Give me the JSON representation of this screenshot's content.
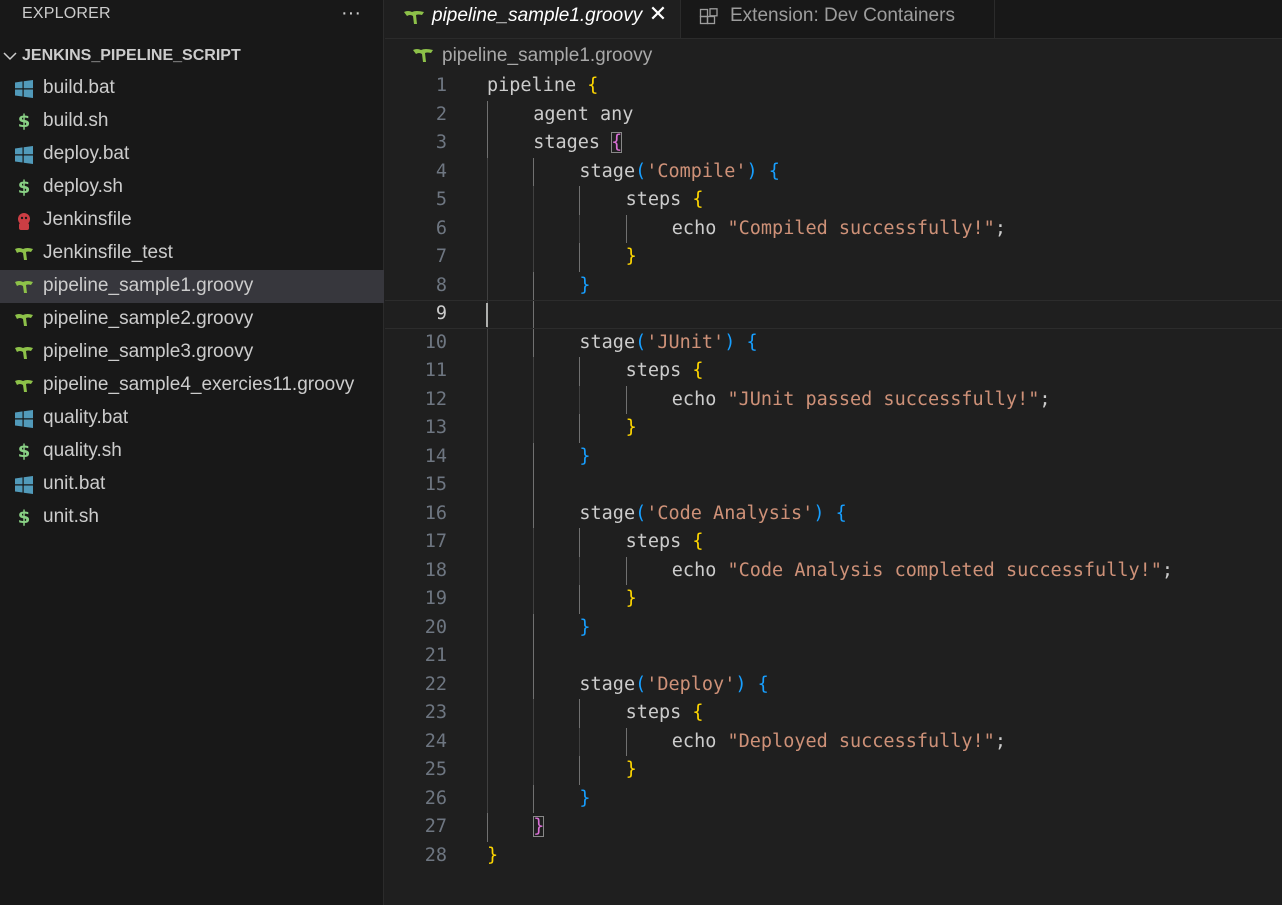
{
  "explorer": {
    "title": "EXPLORER",
    "more": "···",
    "folder_name": "JENKINS_PIPELINE_SCRIPT",
    "files": [
      {
        "name": "build.bat",
        "icon": "windows-icon"
      },
      {
        "name": "build.sh",
        "icon": "dollar-icon"
      },
      {
        "name": "deploy.bat",
        "icon": "windows-icon"
      },
      {
        "name": "deploy.sh",
        "icon": "dollar-icon"
      },
      {
        "name": "Jenkinsfile",
        "icon": "jenkins-icon"
      },
      {
        "name": "Jenkinsfile_test",
        "icon": "groovy-icon"
      },
      {
        "name": "pipeline_sample1.groovy",
        "icon": "groovy-icon",
        "active": true
      },
      {
        "name": "pipeline_sample2.groovy",
        "icon": "groovy-icon"
      },
      {
        "name": "pipeline_sample3.groovy",
        "icon": "groovy-icon"
      },
      {
        "name": "pipeline_sample4_exercies11.groovy",
        "icon": "groovy-icon"
      },
      {
        "name": "quality.bat",
        "icon": "windows-icon"
      },
      {
        "name": "quality.sh",
        "icon": "dollar-icon"
      },
      {
        "name": "unit.bat",
        "icon": "windows-icon"
      },
      {
        "name": "unit.sh",
        "icon": "dollar-icon"
      }
    ]
  },
  "tabs": {
    "active_label": "pipeline_sample1.groovy",
    "close": "✕",
    "ext_label": "Extension: Dev Containers"
  },
  "breadcrumb": {
    "label": "pipeline_sample1.groovy"
  },
  "editor": {
    "current_line": 9,
    "lines": [
      {
        "n": "1",
        "indent": 0,
        "tokens": [
          [
            "kw",
            "pipeline "
          ],
          [
            "b1",
            "{"
          ]
        ]
      },
      {
        "n": "2",
        "indent": 1,
        "tokens": [
          [
            "kw",
            "agent any"
          ]
        ]
      },
      {
        "n": "3",
        "indent": 1,
        "tokens": [
          [
            "kw",
            "stages "
          ],
          [
            "b2",
            "{"
          ]
        ]
      },
      {
        "n": "4",
        "indent": 2,
        "tokens": [
          [
            "kw",
            "stage"
          ],
          [
            "b3",
            "("
          ],
          [
            "str",
            "'Compile'"
          ],
          [
            "b3",
            ")"
          ],
          [
            "plain",
            " "
          ],
          [
            "b3",
            "{"
          ]
        ]
      },
      {
        "n": "5",
        "indent": 3,
        "tokens": [
          [
            "kw",
            "steps "
          ],
          [
            "b1",
            "{"
          ]
        ]
      },
      {
        "n": "6",
        "indent": 4,
        "tokens": [
          [
            "kw",
            "echo "
          ],
          [
            "str",
            "\"Compiled successfully!\""
          ],
          [
            "plain",
            ";"
          ]
        ]
      },
      {
        "n": "7",
        "indent": 3,
        "tokens": [
          [
            "b1",
            "}"
          ]
        ]
      },
      {
        "n": "8",
        "indent": 2,
        "tokens": [
          [
            "b3",
            "}"
          ]
        ]
      },
      {
        "n": "9",
        "indent": 0,
        "tokens": []
      },
      {
        "n": "10",
        "indent": 2,
        "tokens": [
          [
            "kw",
            "stage"
          ],
          [
            "b3",
            "("
          ],
          [
            "str",
            "'JUnit'"
          ],
          [
            "b3",
            ")"
          ],
          [
            "plain",
            " "
          ],
          [
            "b3",
            "{"
          ]
        ]
      },
      {
        "n": "11",
        "indent": 3,
        "tokens": [
          [
            "kw",
            "steps "
          ],
          [
            "b1",
            "{"
          ]
        ]
      },
      {
        "n": "12",
        "indent": 4,
        "tokens": [
          [
            "kw",
            "echo "
          ],
          [
            "str",
            "\"JUnit passed successfully!\""
          ],
          [
            "plain",
            ";"
          ]
        ]
      },
      {
        "n": "13",
        "indent": 3,
        "tokens": [
          [
            "b1",
            "}"
          ]
        ]
      },
      {
        "n": "14",
        "indent": 2,
        "tokens": [
          [
            "b3",
            "}"
          ]
        ]
      },
      {
        "n": "15",
        "indent": 0,
        "tokens": []
      },
      {
        "n": "16",
        "indent": 2,
        "tokens": [
          [
            "kw",
            "stage"
          ],
          [
            "b3",
            "("
          ],
          [
            "str",
            "'Code Analysis'"
          ],
          [
            "b3",
            ")"
          ],
          [
            "plain",
            " "
          ],
          [
            "b3",
            "{"
          ]
        ]
      },
      {
        "n": "17",
        "indent": 3,
        "tokens": [
          [
            "kw",
            "steps "
          ],
          [
            "b1",
            "{"
          ]
        ]
      },
      {
        "n": "18",
        "indent": 4,
        "tokens": [
          [
            "kw",
            "echo "
          ],
          [
            "str",
            "\"Code Analysis completed successfully!\""
          ],
          [
            "plain",
            ";"
          ]
        ]
      },
      {
        "n": "19",
        "indent": 3,
        "tokens": [
          [
            "b1",
            "}"
          ]
        ]
      },
      {
        "n": "20",
        "indent": 2,
        "tokens": [
          [
            "b3",
            "}"
          ]
        ]
      },
      {
        "n": "21",
        "indent": 0,
        "tokens": []
      },
      {
        "n": "22",
        "indent": 2,
        "tokens": [
          [
            "kw",
            "stage"
          ],
          [
            "b3",
            "("
          ],
          [
            "str",
            "'Deploy'"
          ],
          [
            "b3",
            ")"
          ],
          [
            "plain",
            " "
          ],
          [
            "b3",
            "{"
          ]
        ]
      },
      {
        "n": "23",
        "indent": 3,
        "tokens": [
          [
            "kw",
            "steps "
          ],
          [
            "b1",
            "{"
          ]
        ]
      },
      {
        "n": "24",
        "indent": 4,
        "tokens": [
          [
            "kw",
            "echo "
          ],
          [
            "str",
            "\"Deployed successfully!\""
          ],
          [
            "plain",
            ";"
          ]
        ]
      },
      {
        "n": "25",
        "indent": 3,
        "tokens": [
          [
            "b1",
            "}"
          ]
        ]
      },
      {
        "n": "26",
        "indent": 2,
        "tokens": [
          [
            "b3",
            "}"
          ]
        ]
      },
      {
        "n": "27",
        "indent": 1,
        "tokens": [
          [
            "b2",
            "}"
          ]
        ]
      },
      {
        "n": "28",
        "indent": 0,
        "tokens": [
          [
            "b1",
            "}"
          ]
        ]
      }
    ]
  }
}
